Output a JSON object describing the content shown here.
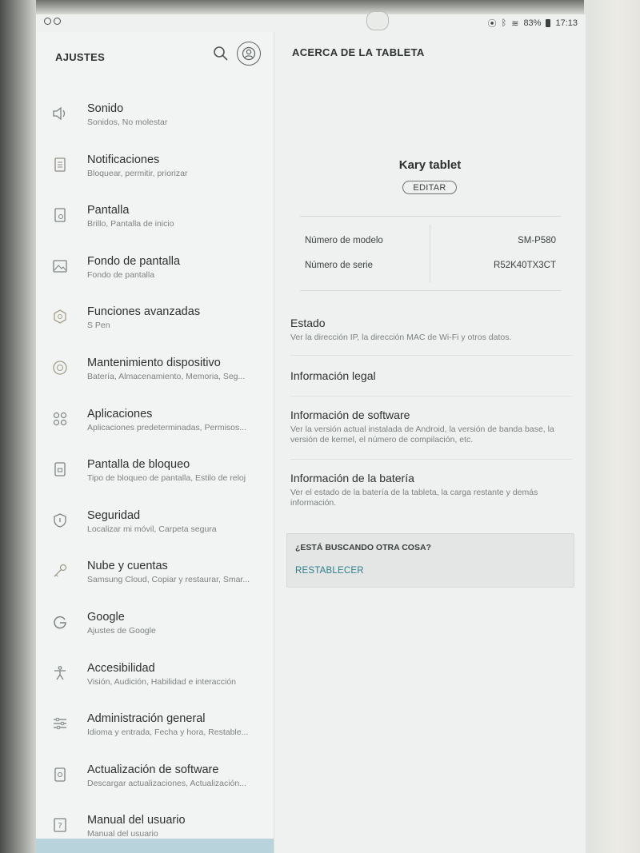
{
  "status_bar": {
    "battery": "83%",
    "time": "17:13"
  },
  "left_panel": {
    "title": "AJUSTES",
    "items": [
      {
        "title": "Sonido",
        "subtitle": "Sonidos, No molestar",
        "icon": "speaker-icon"
      },
      {
        "title": "Notificaciones",
        "subtitle": "Bloquear, permitir, priorizar",
        "icon": "notifications-icon"
      },
      {
        "title": "Pantalla",
        "subtitle": "Brillo, Pantalla de inicio",
        "icon": "display-icon"
      },
      {
        "title": "Fondo de pantalla",
        "subtitle": "Fondo de pantalla",
        "icon": "wallpaper-icon"
      },
      {
        "title": "Funciones avanzadas",
        "subtitle": "S Pen",
        "icon": "advanced-features-icon"
      },
      {
        "title": "Mantenimiento dispositivo",
        "subtitle": "Batería, Almacenamiento, Memoria, Seg...",
        "icon": "device-maintenance-icon"
      },
      {
        "title": "Aplicaciones",
        "subtitle": "Aplicaciones predeterminadas, Permisos...",
        "icon": "apps-icon"
      },
      {
        "title": "Pantalla de bloqueo",
        "subtitle": "Tipo de bloqueo de pantalla, Estilo de reloj",
        "icon": "lock-screen-icon"
      },
      {
        "title": "Seguridad",
        "subtitle": "Localizar mi móvil, Carpeta segura",
        "icon": "shield-icon"
      },
      {
        "title": "Nube y cuentas",
        "subtitle": "Samsung Cloud, Copiar y restaurar, Smar...",
        "icon": "key-icon"
      },
      {
        "title": "Google",
        "subtitle": "Ajustes de Google",
        "icon": "google-icon"
      },
      {
        "title": "Accesibilidad",
        "subtitle": "Visión, Audición, Habilidad e interacción",
        "icon": "accessibility-icon"
      },
      {
        "title": "Administración general",
        "subtitle": "Idioma y entrada, Fecha y hora, Restable...",
        "icon": "sliders-icon"
      },
      {
        "title": "Actualización de software",
        "subtitle": "Descargar actualizaciones, Actualización...",
        "icon": "software-update-icon"
      },
      {
        "title": "Manual del usuario",
        "subtitle": "Manual del usuario",
        "icon": "help-icon"
      }
    ]
  },
  "right_panel": {
    "title": "ACERCA DE LA TABLETA",
    "device_name": "Kary tablet",
    "edit_label": "EDITAR",
    "model_label": "Número de modelo",
    "model_value": "SM-P580",
    "serial_label": "Número de serie",
    "serial_value": "R52K40TX3CT",
    "items": [
      {
        "title": "Estado",
        "subtitle": "Ver la dirección IP, la dirección MAC de Wi-Fi y otros datos."
      },
      {
        "title": "Información legal",
        "subtitle": ""
      },
      {
        "title": "Información de software",
        "subtitle": "Ver la versión actual instalada de Android, la versión de banda base, la versión de kernel, el número de compilación, etc."
      },
      {
        "title": "Información de la batería",
        "subtitle": "Ver el estado de la batería de la tableta, la carga restante y demás información."
      }
    ],
    "looking_title": "¿ESTÁ BUSCANDO OTRA COSA?",
    "reset_label": "RESTABLECER"
  }
}
